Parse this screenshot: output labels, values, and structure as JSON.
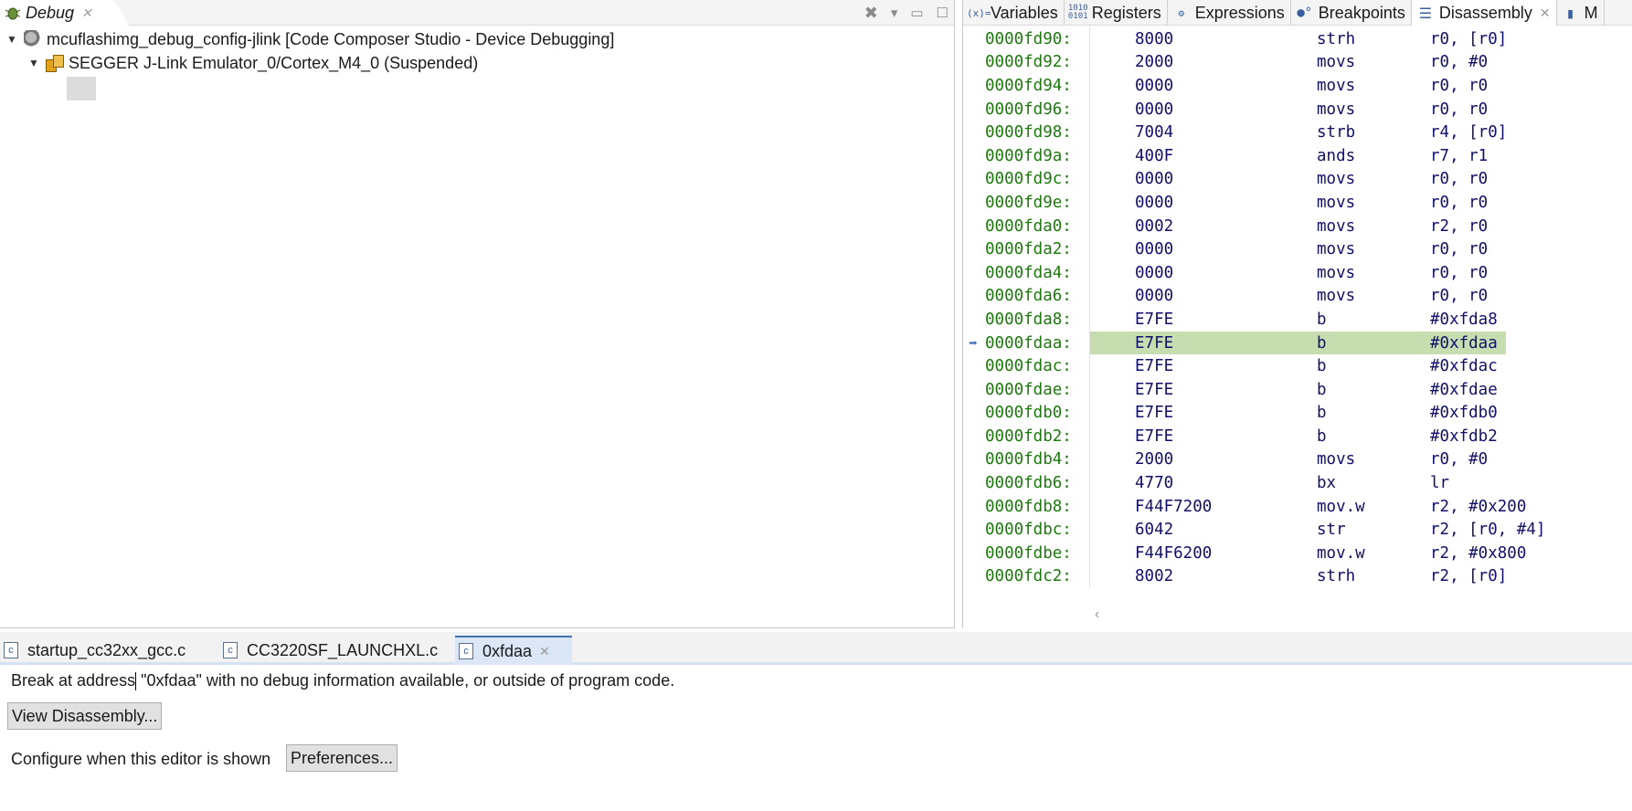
{
  "debug_view": {
    "tab_label": "Debug",
    "tree": [
      {
        "label": "mcuflashimg_debug_config-jlink [Code Composer Studio - Device Debugging]"
      },
      {
        "label": "SEGGER J-Link Emulator_0/Cortex_M4_0 (Suspended)"
      }
    ]
  },
  "right_view": {
    "tabs": [
      {
        "label": "Variables",
        "icon": "(x)="
      },
      {
        "label": "Registers",
        "icon": "1010"
      },
      {
        "label": "Expressions",
        "icon": "expressions-icon"
      },
      {
        "label": "Breakpoints",
        "icon": "breakpoints-icon"
      },
      {
        "label": "Disassembly",
        "icon": "disassembly-icon"
      },
      {
        "label": "M",
        "icon": "memory-icon"
      }
    ],
    "disassembly": [
      {
        "addr": "0000fd90:",
        "op": "8000",
        "mn": "strh",
        "args": "r0, [r0]"
      },
      {
        "addr": "0000fd92:",
        "op": "2000",
        "mn": "movs",
        "args": "r0, #0"
      },
      {
        "addr": "0000fd94:",
        "op": "0000",
        "mn": "movs",
        "args": "r0, r0"
      },
      {
        "addr": "0000fd96:",
        "op": "0000",
        "mn": "movs",
        "args": "r0, r0"
      },
      {
        "addr": "0000fd98:",
        "op": "7004",
        "mn": "strb",
        "args": "r4, [r0]"
      },
      {
        "addr": "0000fd9a:",
        "op": "400F",
        "mn": "ands",
        "args": "r7, r1"
      },
      {
        "addr": "0000fd9c:",
        "op": "0000",
        "mn": "movs",
        "args": "r0, r0"
      },
      {
        "addr": "0000fd9e:",
        "op": "0000",
        "mn": "movs",
        "args": "r0, r0"
      },
      {
        "addr": "0000fda0:",
        "op": "0002",
        "mn": "movs",
        "args": "r2, r0"
      },
      {
        "addr": "0000fda2:",
        "op": "0000",
        "mn": "movs",
        "args": "r0, r0"
      },
      {
        "addr": "0000fda4:",
        "op": "0000",
        "mn": "movs",
        "args": "r0, r0"
      },
      {
        "addr": "0000fda6:",
        "op": "0000",
        "mn": "movs",
        "args": "r0, r0"
      },
      {
        "addr": "0000fda8:",
        "op": "E7FE",
        "mn": "b",
        "args": "#0xfda8"
      },
      {
        "addr": "0000fdaa:",
        "op": "E7FE",
        "mn": "b",
        "args": "#0xfdaa",
        "current": true
      },
      {
        "addr": "0000fdac:",
        "op": "E7FE",
        "mn": "b",
        "args": "#0xfdac"
      },
      {
        "addr": "0000fdae:",
        "op": "E7FE",
        "mn": "b",
        "args": "#0xfdae"
      },
      {
        "addr": "0000fdb0:",
        "op": "E7FE",
        "mn": "b",
        "args": "#0xfdb0"
      },
      {
        "addr": "0000fdb2:",
        "op": "E7FE",
        "mn": "b",
        "args": "#0xfdb2"
      },
      {
        "addr": "0000fdb4:",
        "op": "2000",
        "mn": "movs",
        "args": "r0, #0"
      },
      {
        "addr": "0000fdb6:",
        "op": "4770",
        "mn": "bx",
        "args": "lr"
      },
      {
        "addr": "0000fdb8:",
        "op": "F44F7200",
        "mn": "mov.w",
        "args": "r2, #0x200"
      },
      {
        "addr": "0000fdbc:",
        "op": "6042",
        "mn": "str",
        "args": "r2, [r0, #4]"
      },
      {
        "addr": "0000fdbe:",
        "op": "F44F6200",
        "mn": "mov.w",
        "args": "r2, #0x800"
      },
      {
        "addr": "0000fdc2:",
        "op": "8002",
        "mn": "strh",
        "args": "r2, [r0]"
      }
    ],
    "colors": {
      "address": "#1a7b0a",
      "code": "#10106a",
      "current_line": "#c7ddb0"
    }
  },
  "editor": {
    "tabs": [
      {
        "label": "startup_cc32xx_gcc.c"
      },
      {
        "label": "CC3220SF_LAUNCHXL.c"
      },
      {
        "label": "0xfdaa",
        "active": true
      }
    ],
    "message_prefix": "Break at address",
    "message_suffix": " \"0xfdaa\" with no debug information available, or outside of program code.",
    "view_disassembly_button": "View Disassembly...",
    "configure_label": "Configure when this editor is shown",
    "preferences_button": "Preferences..."
  }
}
